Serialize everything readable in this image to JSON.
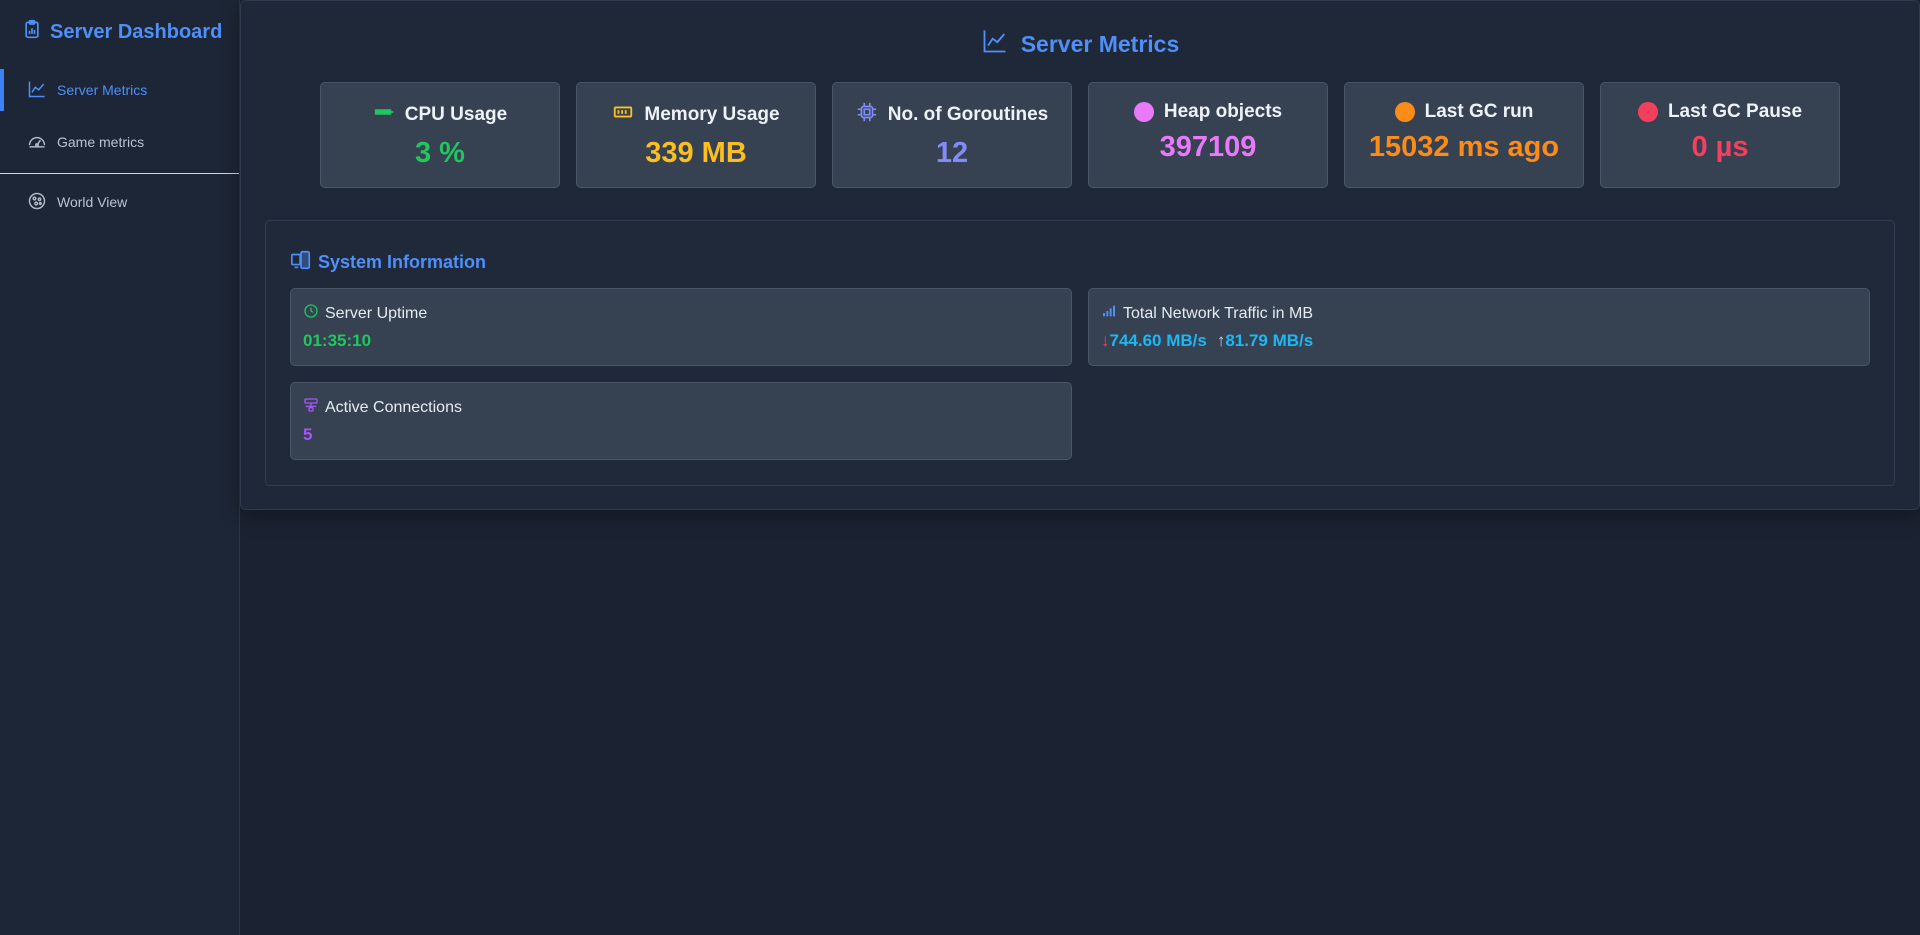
{
  "sidebar": {
    "brand": "Server Dashboard",
    "items": [
      {
        "label": "Server Metrics",
        "icon": "line-chart-icon",
        "active": true
      },
      {
        "label": "Game metrics",
        "icon": "gauge-icon",
        "active": false
      },
      {
        "label": "World View",
        "icon": "globe-icon",
        "active": false
      }
    ]
  },
  "panel": {
    "title": "Server Metrics",
    "cards": [
      {
        "label": "CPU Usage",
        "value": "3 %",
        "icon": "battery-icon",
        "color": "#22c55e"
      },
      {
        "label": "Memory Usage",
        "value": "339 MB",
        "icon": "memory-icon",
        "color": "#fbbf24"
      },
      {
        "label": "No. of Goroutines",
        "value": "12",
        "icon": "cpu-icon",
        "color": "#818cf8"
      },
      {
        "label": "Heap objects",
        "value": "397109",
        "icon": "dot-icon",
        "color": "#e879f9"
      },
      {
        "label": "Last GC run",
        "value": "15032 ms ago",
        "icon": "dot-icon",
        "color": "#fb8c1a"
      },
      {
        "label": "Last GC Pause",
        "value": "0 µs",
        "icon": "dot-icon",
        "color": "#f43f5e"
      }
    ]
  },
  "system": {
    "title": "System Information",
    "uptime": {
      "label": "Server Uptime",
      "value": "01:35:10",
      "color": "#22c55e"
    },
    "network": {
      "label": "Total Network Traffic in MB",
      "down": "744.60 MB/s",
      "up": "81.79 MB/s",
      "color": "#1fb6f2",
      "down_arrow_color": "#f43f5e"
    },
    "connections": {
      "label": "Active Connections",
      "value": "5",
      "color": "#a855f7"
    }
  }
}
